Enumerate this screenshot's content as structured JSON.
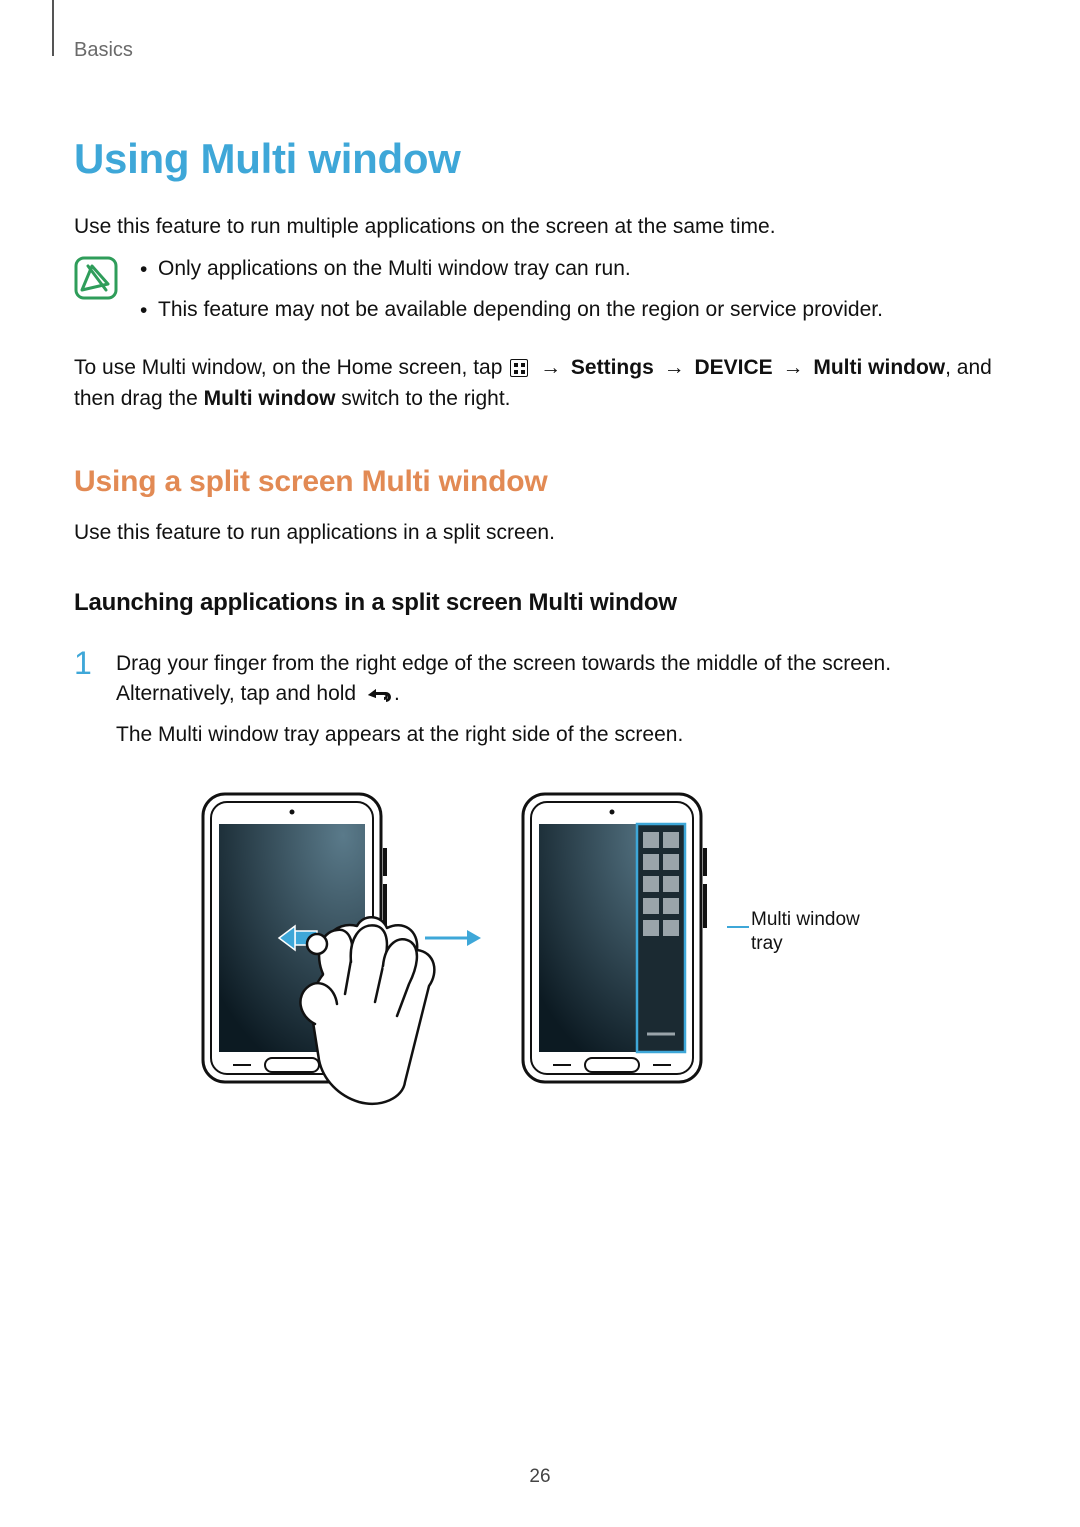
{
  "breadcrumb": "Basics",
  "h1": "Using Multi window",
  "intro": "Use this feature to run multiple applications on the screen at the same time.",
  "notes": [
    "Only applications on the Multi window tray can run.",
    "This feature may not be available depending on the region or service provider."
  ],
  "instruction": {
    "prefix": "To use Multi window, on the Home screen, tap ",
    "arrow": "→",
    "settings": "Settings",
    "device": "DEVICE",
    "multiwindow": "Multi window",
    "midfix": ", and then drag the ",
    "switch_label": "Multi window",
    "suffix": " switch to the right."
  },
  "h2": "Using a split screen Multi window",
  "sub_intro": "Use this feature to run applications in a split screen.",
  "h3": "Launching applications in a split screen Multi window",
  "step1": {
    "num": "1",
    "line1a": "Drag your finger from the right edge of the screen towards the middle of the screen. Alternatively, tap and hold ",
    "line1b": ".",
    "line2": "The Multi window tray appears at the right side of the screen."
  },
  "callout": "Multi window tray",
  "page_number": "26"
}
